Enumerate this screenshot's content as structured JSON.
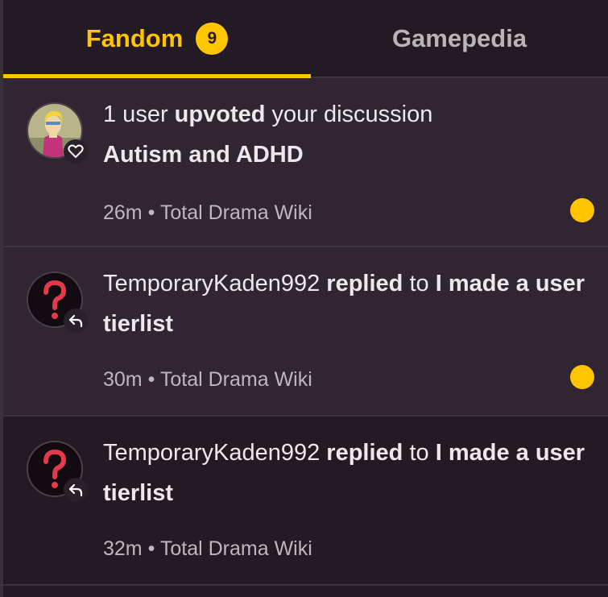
{
  "tabs": {
    "fandom": {
      "label": "Fandom",
      "count": "9"
    },
    "gamepedia": {
      "label": "Gamepedia"
    }
  },
  "colors": {
    "accent": "#ffc500",
    "background": "#241a24",
    "unread_background": "#302530"
  },
  "notifications": [
    {
      "state": "unread",
      "avatar_icon": "user-avatar-cartoon",
      "action_icon": "heart-icon",
      "count_text": "1 user",
      "verb": "upvoted",
      "suffix": "your discussion",
      "title": "Autism and ADHD",
      "time": "26m",
      "separator": "•",
      "wiki": "Total Drama Wiki"
    },
    {
      "state": "unread",
      "avatar_icon": "question-mark-avatar",
      "action_icon": "reply-arrow-icon",
      "user": "TemporaryKaden992",
      "verb": "replied",
      "connector": "to",
      "title": "I made a user tierlist",
      "time": "30m",
      "separator": "•",
      "wiki": "Total Drama Wiki"
    },
    {
      "state": "read",
      "avatar_icon": "question-mark-avatar",
      "action_icon": "reply-arrow-icon",
      "user": "TemporaryKaden992",
      "verb": "replied",
      "connector": "to",
      "title": "I made a user tierlist",
      "time": "32m",
      "separator": "•",
      "wiki": "Total Drama Wiki"
    }
  ]
}
